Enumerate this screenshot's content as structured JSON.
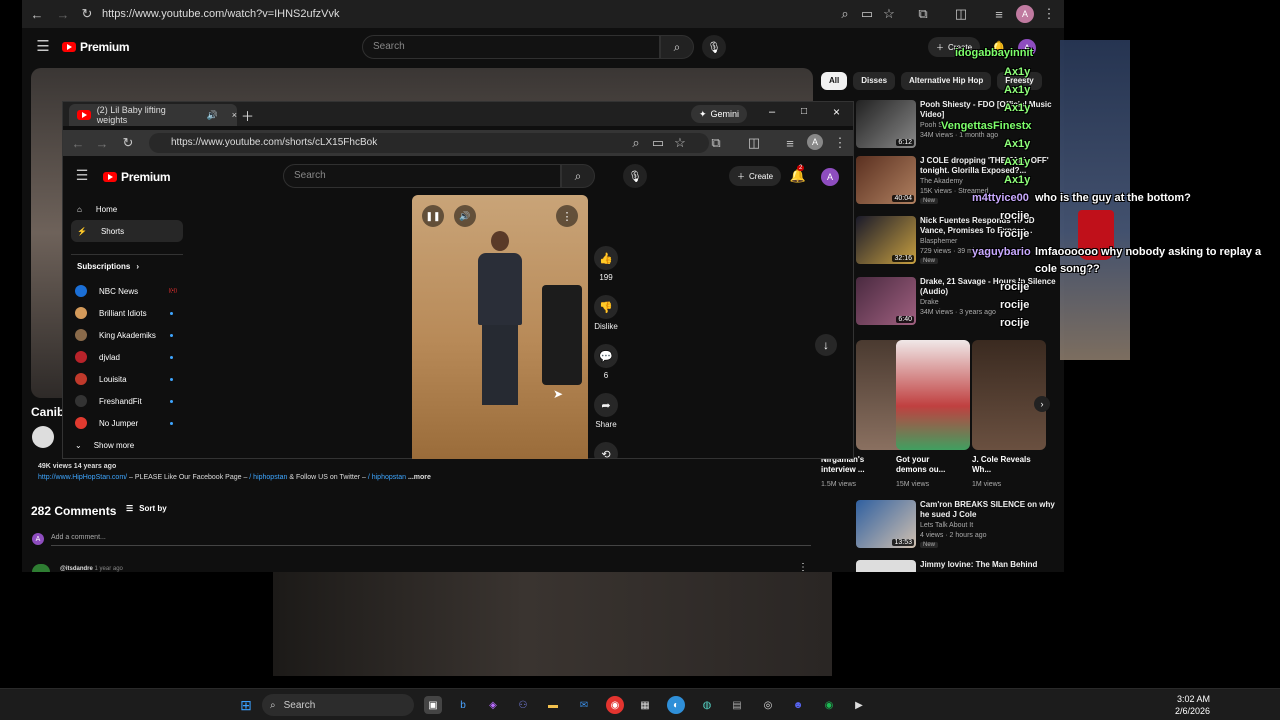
{
  "back_browser": {
    "url": "https://www.youtube.com/watch?v=IHNS2ufzVvk",
    "yt": {
      "logo": "Premium",
      "search_placeholder": "Search",
      "create_label": "Create",
      "notif_count": "2",
      "avatar": "A"
    },
    "chips": [
      "All",
      "Disses",
      "Alternative Hip Hop",
      "Freesty"
    ],
    "video_title_partial": "Canibu",
    "description": {
      "meta": "49K views  14 years ago",
      "link": "http://www.HipHopStan.com/",
      "text": " – PLEASE Like Our Facebook Page –",
      "handle1": " / hiphopstan",
      "text2": " & Follow US on Twitter – ",
      "handle2": " / hiphopstan",
      "more": " ...more"
    },
    "comments": {
      "count": "282 Comments",
      "sort_label": "Sort by",
      "add_placeholder": "Add a comment...",
      "first_user": "@itsdandre",
      "first_time": "1 year ago"
    },
    "recommendations": [
      {
        "title": "Pooh Shiesty - FDO [Official Music Video]",
        "channel": "Pooh Shiesty",
        "views": "34M views · 1 month ago",
        "duration": "6:12",
        "new": ""
      },
      {
        "title": "J COLE dropping 'THE FALL-OFF' tonight. Glorilla Exposed?...",
        "channel": "The Akademy",
        "views": "15K views · Streamed",
        "duration": "40:04",
        "new": "New"
      },
      {
        "title": "Nick Fuentes Responds To JD Vance, Promises To Expose...",
        "channel": "Blasphemer",
        "views": "729 views · 39 minutes",
        "duration": "32:16",
        "new": "New"
      },
      {
        "title": "Drake, 21 Savage - Hours In Silence (Audio)",
        "channel": "Drake",
        "views": "34M views · 3 years ago",
        "duration": "6:40",
        "new": ""
      }
    ],
    "shorts": [
      {
        "title": "Nirgaman's interview ...",
        "views": "1.5M views"
      },
      {
        "title": "Got your demons ou...",
        "views": "15M views"
      },
      {
        "title": "J. Cole Reveals Wh...",
        "views": "1M views"
      }
    ],
    "recommendations2": [
      {
        "title": "Cam'ron BREAKS SILENCE on why he sued J Cole",
        "channel": "Lets Talk About It",
        "views": "4 views · 2 hours ago",
        "duration": "13:53",
        "new": "New"
      },
      {
        "title": "Jimmy Iovine: The Man Behind",
        "channel": "",
        "views": "",
        "duration": "",
        "new": ""
      }
    ]
  },
  "front_browser": {
    "tab_title": "(2) Lil Baby lifting weights",
    "gemini_label": "Gemini",
    "url": "https://www.youtube.com/shorts/cLX15FhcBok",
    "yt": {
      "logo": "Premium",
      "search_placeholder": "Search",
      "create_label": "Create",
      "notif_count": "2",
      "avatar": "A"
    },
    "sidebar": {
      "items": [
        {
          "label": "Home"
        },
        {
          "label": "Shorts"
        }
      ],
      "subs_heading": "Subscriptions",
      "subs": [
        {
          "label": "NBC News",
          "color": "#1b6fd6",
          "badge": "live"
        },
        {
          "label": "Brilliant Idiots",
          "color": "#d49a5a"
        },
        {
          "label": "King Akademiks",
          "color": "#8a6a4a"
        },
        {
          "label": "djvlad",
          "color": "#b8232a"
        },
        {
          "label": "Louisita",
          "color": "#c0392b"
        },
        {
          "label": "FreshandFit",
          "color": "#333333"
        },
        {
          "label": "No Jumper",
          "color": "#e03a2f"
        }
      ],
      "show_more": "Show more"
    },
    "actions": {
      "like_count": "199",
      "dislike_label": "Dislike",
      "comment_count": "6",
      "share_label": "Share"
    }
  },
  "chat": [
    {
      "user": "idogabbayinnit",
      "msg": "",
      "color": "green"
    },
    {
      "user": "Ax1y",
      "msg": "",
      "color": "ax"
    },
    {
      "user": "Ax1y",
      "msg": "",
      "color": "ax"
    },
    {
      "user": "Ax1y",
      "msg": "",
      "color": "ax"
    },
    {
      "user": "VengettasFinestx",
      "msg": "",
      "color": "green"
    },
    {
      "user": "Ax1y",
      "msg": "",
      "color": "ax"
    },
    {
      "user": "Ax1y",
      "msg": "",
      "color": "ax"
    },
    {
      "user": "Ax1y",
      "msg": "",
      "color": "ax"
    },
    {
      "user": "m4ttyice00",
      "msg": "who is the guy at the bottom?",
      "color": "purple"
    },
    {
      "user": "rocije",
      "msg": "",
      "color": "white"
    },
    {
      "user": "rocije",
      "msg": "",
      "color": "white"
    },
    {
      "user": "yaguybario",
      "msg": "lmfaoooooo why nobody asking to replay a",
      "color": "purple"
    },
    {
      "user": "",
      "msg": "cole song??",
      "color": "white"
    },
    {
      "user": "rocije",
      "msg": "",
      "color": "white"
    },
    {
      "user": "rocije",
      "msg": "",
      "color": "white"
    },
    {
      "user": "rocije",
      "msg": "",
      "color": "white"
    }
  ],
  "taskbar": {
    "search_placeholder": "Search",
    "time": "3:02 AM",
    "date": "2/6/2026"
  }
}
